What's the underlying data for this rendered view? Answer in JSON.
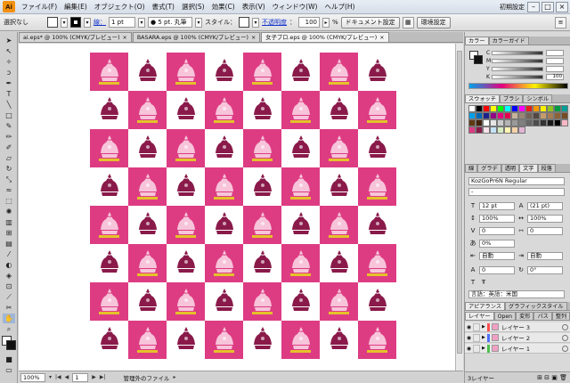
{
  "app": {
    "logo": "Ai"
  },
  "menu": [
    "ファイル(F)",
    "編集(E)",
    "オブジェクト(O)",
    "書式(T)",
    "選択(S)",
    "効果(C)",
    "表示(V)",
    "ウィンドウ(W)",
    "ヘルプ(H)"
  ],
  "menu_right": {
    "workspace_label": "初期設定",
    "minimize": "–",
    "restore": "□",
    "close": "×"
  },
  "controlbar": {
    "selection": "選択なし",
    "stroke_label": "線：",
    "stroke_weight": "1 pt",
    "brush": "● 5 pt. 丸筆",
    "style_label": "スタイル：",
    "opacity_label": "不透明度",
    "opacity_value": "100",
    "opacity_unit": "%",
    "doc_setup": "ドキュメント設定",
    "prefs": "環境設定"
  },
  "doc_tabs": [
    {
      "label": "ai.eps* @ 100% (CMYK/プレビュー)",
      "close": "×",
      "active": false
    },
    {
      "label": "BASARA.eps @ 100% (CMYK/プレビュー)",
      "close": "×",
      "active": false
    },
    {
      "label": "女子プロ.eps @ 100% (CMYK/プレビュー)",
      "close": "×",
      "active": true
    }
  ],
  "status": {
    "zoom": "100%",
    "page": "1",
    "info": "管理外のファイル"
  },
  "panels": {
    "color_tabs": [
      "カラー",
      "カラーガイド"
    ],
    "color_channels": [
      {
        "label": "C",
        "value": ""
      },
      {
        "label": "M",
        "value": ""
      },
      {
        "label": "Y",
        "value": ""
      },
      {
        "label": "K",
        "value": "100"
      }
    ],
    "swatch_tabs": [
      "スウォッチ",
      "ブラシ",
      "シンボル"
    ],
    "swatch_colors": [
      "#ffffff",
      "#000000",
      "#ff0000",
      "#ffff00",
      "#00ff00",
      "#00ffff",
      "#0000ff",
      "#ff00ff",
      "#e8201a",
      "#f39800",
      "#fff100",
      "#8fc31f",
      "#009944",
      "#009e96",
      "#00a0e9",
      "#0068b7",
      "#1d2088",
      "#920783",
      "#e4007f",
      "#e5004f",
      "#c7b299",
      "#998675",
      "#736357",
      "#534741",
      "#c69c6d",
      "#a67c52",
      "#8c6239",
      "#754c24",
      "#603913",
      "#42210b",
      "#ffffff",
      "#e6e6e6",
      "#cccccc",
      "#b3b3b3",
      "#999999",
      "#808080",
      "#666666",
      "#4d4d4d",
      "#333333",
      "#1a1a1a",
      "#000000",
      "#f7b7c7",
      "#dd3c83",
      "#8a1a4a",
      "#fbe3ec",
      "#c4e2f5",
      "#d5ecc2",
      "#fff4b3",
      "#f4d1a8",
      "#e0b4d6"
    ],
    "char_tabs": [
      "線",
      "グラデ",
      "透明",
      "文字",
      "段落"
    ],
    "char_active_tab": 3,
    "font_family": "KozGoPr6N Regular",
    "font_style": "-",
    "font_size": "12 pt",
    "leading": "(21 pt)",
    "vscale": "100%",
    "hscale": "100%",
    "kerning": "0",
    "tracking": "0",
    "baseline": "0%",
    "auto1": "自動",
    "auto2": "自動",
    "rotate": "0°",
    "language": "言語：英語：米国",
    "appearance_tabs": [
      "アピアランス",
      "グラフィックスタイル"
    ],
    "layer_tabs": [
      "レイヤー",
      "Open",
      "変形",
      "パス",
      "整列"
    ],
    "layers": [
      {
        "name": "レイヤー 3",
        "color": "#ff4f4f",
        "eye": "◉"
      },
      {
        "name": "レイヤー 2",
        "color": "#4f6fff",
        "eye": "◉"
      },
      {
        "name": "レイヤー 1",
        "color": "#4fbf4f",
        "eye": "◉"
      }
    ],
    "layers_count": "3レイヤー"
  },
  "artwork": {
    "pink": "#dd3c83",
    "tiara_on_pink": "#f7c4da",
    "tiara_on_white": "#8a1a4a",
    "band_color": "#e5c22a"
  }
}
